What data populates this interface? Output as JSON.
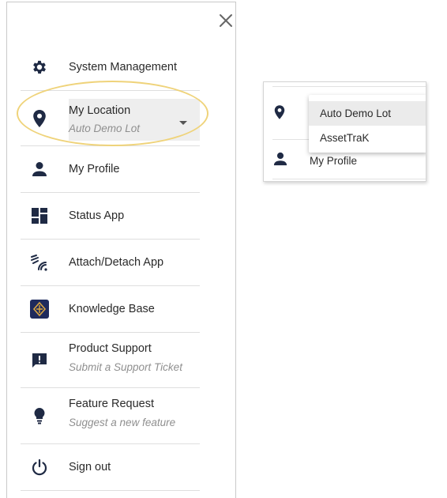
{
  "menu": {
    "items": [
      {
        "id": "system-management",
        "label": "System Management"
      },
      {
        "id": "my-location",
        "label": "My Location",
        "selected_value": "Auto Demo Lot"
      },
      {
        "id": "my-profile",
        "label": "My Profile"
      },
      {
        "id": "status-app",
        "label": "Status App"
      },
      {
        "id": "attach-detach-app",
        "label": "Attach/Detach App"
      },
      {
        "id": "knowledge-base",
        "label": "Knowledge Base"
      },
      {
        "id": "product-support",
        "label": "Product Support",
        "sub": "Submit a Support Ticket"
      },
      {
        "id": "feature-request",
        "label": "Feature Request",
        "sub": "Suggest a new feature"
      },
      {
        "id": "sign-out",
        "label": "Sign out"
      }
    ]
  },
  "location_dropdown": {
    "options": [
      "Auto Demo Lot",
      "AssetTraK"
    ],
    "selected": "Auto Demo Lot",
    "profile_label": "My Profile"
  },
  "colors": {
    "icon": "#1f2a44",
    "highlight": "#efd37a",
    "kb_tile": "#1f2a5c",
    "kb_logo": "#d9a441"
  }
}
